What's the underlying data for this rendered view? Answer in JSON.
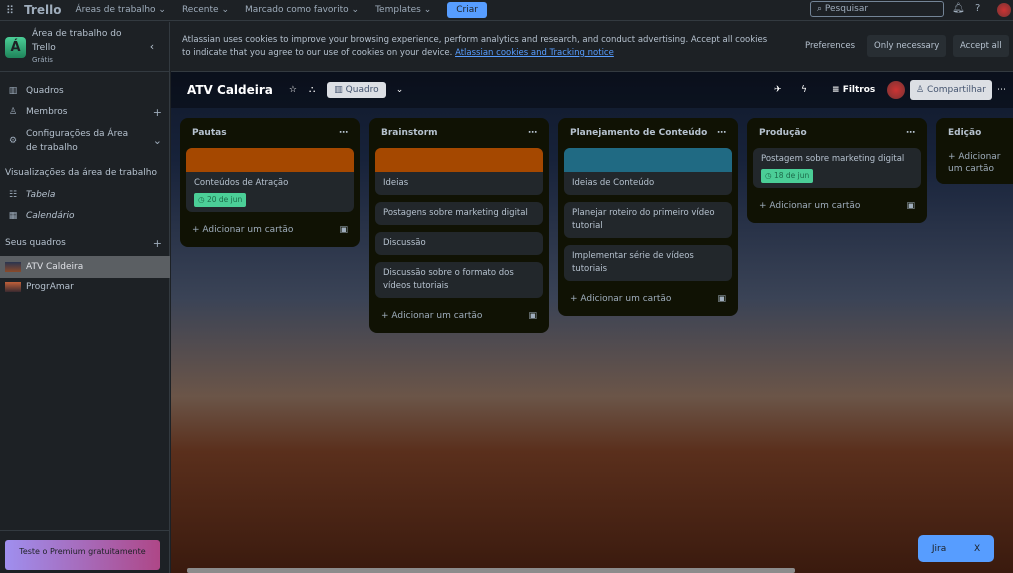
{
  "topbar": {
    "app": "Trello",
    "nav": [
      "Áreas de trabalho",
      "Recente",
      "Marcado como favorito",
      "Templates"
    ],
    "create": "Criar",
    "search_placeholder": "Pesquisar"
  },
  "sidebar": {
    "workspace": "Área de trabalho do Trello",
    "workspace_letter": "Á",
    "plan": "Grátis",
    "items": [
      {
        "label": "Quadros"
      },
      {
        "label": "Membros"
      },
      {
        "label": "Configurações da Área de trabalho"
      }
    ],
    "views_heading": "Visualizações da área de trabalho",
    "views": [
      "Tabela",
      "Calendário"
    ],
    "boards_heading": "Seus quadros",
    "boards": [
      "ATV Caldeira",
      "ProgrAmar"
    ],
    "premium": "Teste o Premium gratuitamente"
  },
  "cookie": {
    "text": "Atlassian uses cookies to improve your browsing experience, perform analytics and research, and conduct advertising. Accept all cookies to indicate that you agree to our use of cookies on your device.",
    "link": "Atlassian cookies and Tracking notice",
    "preferences": "Preferences",
    "only_necessary": "Only necessary",
    "accept_all": "Accept all"
  },
  "board": {
    "title": "ATV Caldeira",
    "view": "Quadro",
    "filters": "Filtros",
    "share": "Compartilhar",
    "add_card": "Adicionar um cartão",
    "lists": [
      {
        "title": "Pautas",
        "cards": [
          {
            "title": "Conteúdos de Atração",
            "cover": "#a54800",
            "due": "20 de jun"
          }
        ]
      },
      {
        "title": "Brainstorm",
        "cards": [
          {
            "title": "Ideias",
            "cover": "#a54800"
          },
          {
            "title": "Postagens sobre marketing digital"
          },
          {
            "title": "Discussão"
          },
          {
            "title": "Discussão sobre o formato dos vídeos tutoriais"
          }
        ]
      },
      {
        "title": "Planejamento de Conteúdo",
        "cards": [
          {
            "title": "Ideias de Conteúdo",
            "cover": "#206a83"
          },
          {
            "title": "Planejar roteiro do primeiro vídeo tutorial"
          },
          {
            "title": "Implementar série de vídeos tutoriais"
          }
        ]
      },
      {
        "title": "Produção",
        "cards": [
          {
            "title": "Postagem sobre marketing digital",
            "due": "18 de jun"
          }
        ]
      },
      {
        "title": "Edição",
        "cards": []
      }
    ]
  },
  "jira": {
    "label": "Jira",
    "close": "X"
  }
}
